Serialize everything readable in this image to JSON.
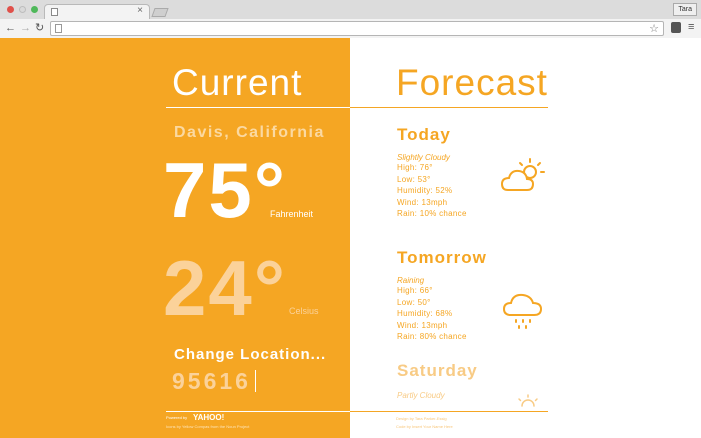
{
  "browser": {
    "user_label": "Tara",
    "tab_close": "×",
    "back": "←",
    "forward": "→",
    "reload": "↻",
    "star": "☆",
    "menu": "≡"
  },
  "current": {
    "heading": "Current",
    "location": "Davis, California",
    "fahrenheit_value": "75°",
    "fahrenheit_label": "Fahrenheit",
    "celsius_value": "24°",
    "celsius_label": "Celsius",
    "change_location_label": "Change Location...",
    "zip_value": "95616"
  },
  "forecast": {
    "heading": "Forecast",
    "days": [
      {
        "name": "Today",
        "condition": "Slightly Cloudy",
        "high": "High: 76°",
        "low": "Low: 53°",
        "humidity": "Humidity: 52%",
        "wind": "Wind: 13mph",
        "rain": "Rain: 10% chance",
        "icon": "partly-cloudy-icon"
      },
      {
        "name": "Tomorrow",
        "condition": "Raining",
        "high": "High: 66°",
        "low": "Low: 50°",
        "humidity": "Humidity: 68%",
        "wind": "Wind: 13mph",
        "rain": "Rain: 80% chance",
        "icon": "rain-cloud-icon"
      },
      {
        "name": "Saturday",
        "condition": "Partly Cloudy",
        "icon": "sun-icon"
      }
    ]
  },
  "footer": {
    "powered_by": "Powered by",
    "yahoo": "YAHOO!",
    "icons_credit": "Icons by Yellow Compas from the Noun Project",
    "design_credit": "Design by Tara Parker-Essig",
    "code_credit": "Code by Insert Your Name Here"
  },
  "colors": {
    "accent": "#f5a623",
    "white": "#ffffff"
  }
}
